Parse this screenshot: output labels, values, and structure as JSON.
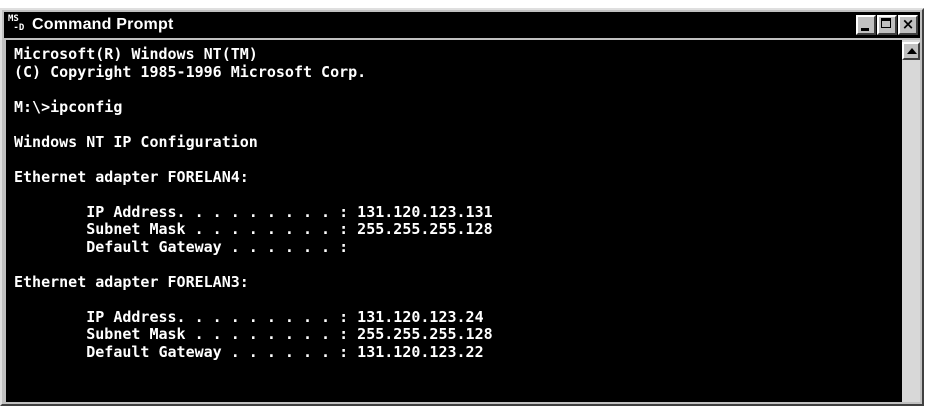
{
  "window": {
    "title": "Command Prompt",
    "icon": "ms-dos-icon",
    "controls": {
      "minimize": "minimize-icon",
      "maximize": "maximize-icon",
      "close": "close-icon"
    }
  },
  "console": {
    "lines": [
      "Microsoft(R) Windows NT(TM)",
      "(C) Copyright 1985-1996 Microsoft Corp.",
      "",
      "M:\\>ipconfig",
      "",
      "Windows NT IP Configuration",
      "",
      "Ethernet adapter FORELAN4:",
      "",
      "        IP Address. . . . . . . . . : 131.120.123.131",
      "        Subnet Mask . . . . . . . . : 255.255.255.128",
      "        Default Gateway . . . . . . :",
      "",
      "Ethernet adapter FORELAN3:",
      "",
      "        IP Address. . . . . . . . . : 131.120.123.24",
      "        Subnet Mask . . . . . . . . : 255.255.255.128",
      "        Default Gateway . . . . . . : 131.120.123.22"
    ]
  },
  "scrollbar": {
    "up_arrow": "up-arrow-icon"
  },
  "colors": {
    "console_bg": "#000000",
    "console_fg": "#ffffff",
    "titlebar_bg": "#000000",
    "chrome": "#c0c0c0"
  }
}
